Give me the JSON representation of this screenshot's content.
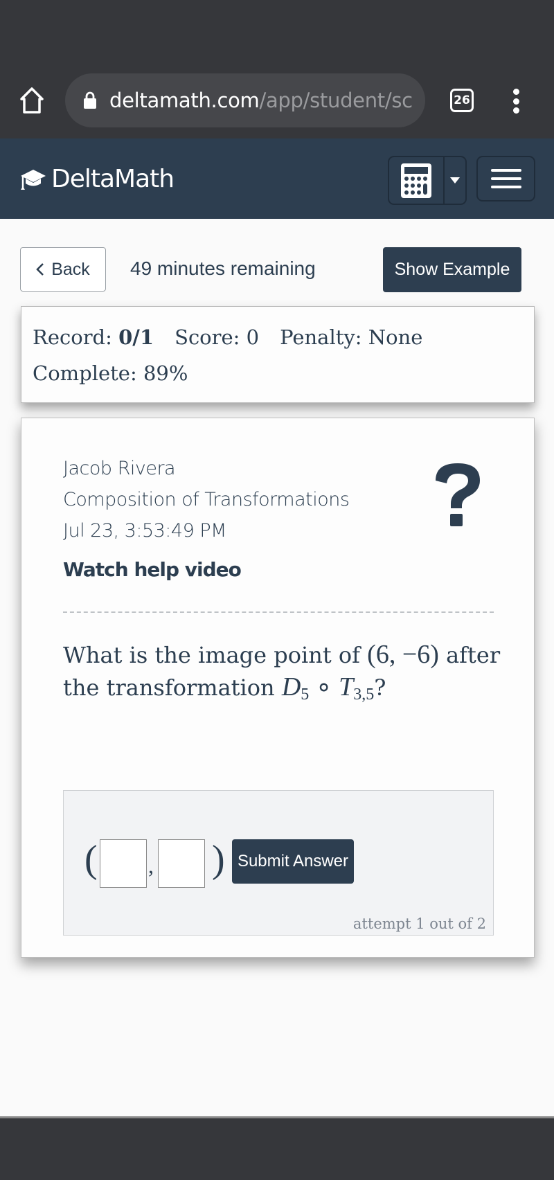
{
  "browser": {
    "url_host": "deltamath.com",
    "url_path": "/app/student/sc",
    "tab_count": "26",
    "icons": {
      "home": "home-icon",
      "lock": "lock-icon",
      "tabs": "tab-switcher-icon",
      "more": "more-vertical-icon"
    }
  },
  "navbar": {
    "brand": "DeltaMath",
    "icons": {
      "logo": "graduation-cap-icon",
      "calculator": "calculator-icon",
      "caret": "caret-down-icon",
      "menu": "hamburger-menu-icon"
    }
  },
  "toolbar": {
    "back_label": "Back",
    "timer": "49 minutes remaining",
    "show_example_label": "Show Example"
  },
  "stats": {
    "record_label": "Record:",
    "record_value": "0/1",
    "score": "Score: 0",
    "penalty": "Penalty: None",
    "complete": "Complete: 89%"
  },
  "problem": {
    "student_name": "Jacob Rivera",
    "topic": "Composition of Transformations",
    "timestamp": "Jul 23, 3:53:49 PM",
    "help_video_label": "Watch help video",
    "question_prefix": "What is the image point of",
    "point": "(6, −6)",
    "question_middle": "after the transformation",
    "d_symbol": "D",
    "d_sub": "5",
    "compose": "∘",
    "t_symbol": "T",
    "t_sub": "3,5",
    "question_suffix": "?"
  },
  "answer": {
    "open_paren": "(",
    "comma": ",",
    "close_paren": ")",
    "x_value": "",
    "y_value": "",
    "submit_label": "Submit Answer",
    "attempt_text": "attempt 1 out of 2"
  },
  "colors": {
    "brand_navy": "#2d3e50",
    "chrome_dark": "#36373b",
    "answer_bg": "#f2f3f5"
  }
}
